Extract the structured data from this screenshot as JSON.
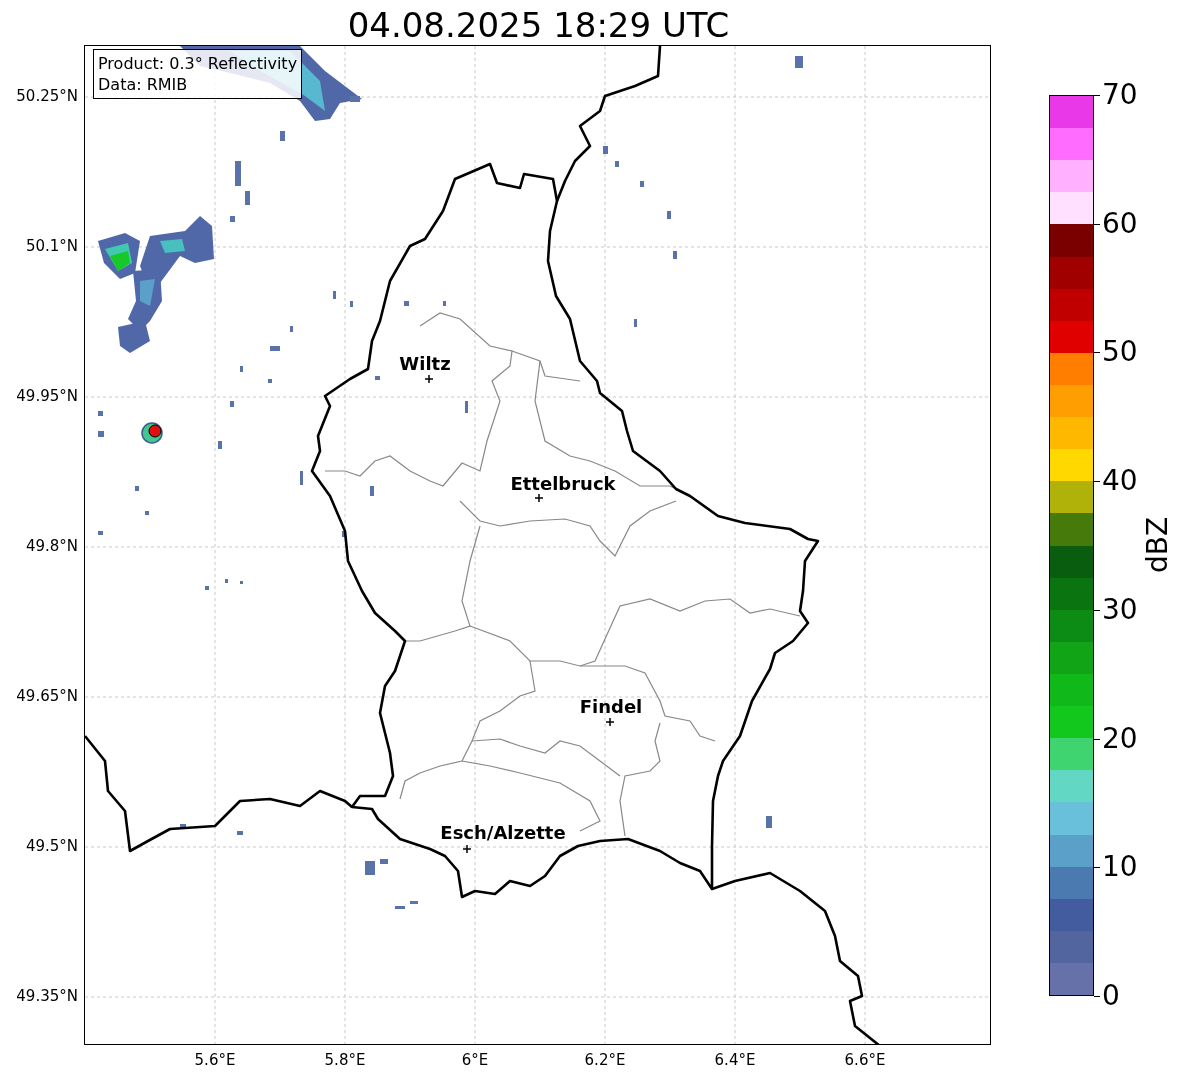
{
  "title": "04.08.2025 18:29 UTC",
  "info_box": {
    "lines": [
      "Product: 0.3° Reflectivity",
      "Data: RMIB"
    ]
  },
  "map": {
    "cities": [
      {
        "name": "Wiltz"
      },
      {
        "name": "Ettelbruck"
      },
      {
        "name": "Findel"
      },
      {
        "name": "Esch/Alzette"
      }
    ],
    "lon_labels": [
      "5.6°E",
      "5.8°E",
      "6°E",
      "6.2°E",
      "6.4°E",
      "6.6°E"
    ],
    "lat_labels": [
      "50.25°N",
      "50.1°N",
      "49.95°N",
      "49.8°N",
      "49.65°N",
      "49.5°N",
      "49.35°N"
    ]
  },
  "colorbar": {
    "label": "dBZ",
    "ticks": [
      "70",
      "60",
      "50",
      "40",
      "30",
      "20",
      "10",
      "0"
    ],
    "bins": [
      {
        "color": "#e838e8"
      },
      {
        "color": "#ff6cff"
      },
      {
        "color": "#ffb0ff"
      },
      {
        "color": "#ffe0ff"
      },
      {
        "color": "#7a0000"
      },
      {
        "color": "#a00000"
      },
      {
        "color": "#c00000"
      },
      {
        "color": "#e00000"
      },
      {
        "color": "#ff7e00"
      },
      {
        "color": "#ff9e00"
      },
      {
        "color": "#ffb800"
      },
      {
        "color": "#ffd800"
      },
      {
        "color": "#b0b20a"
      },
      {
        "color": "#467a0a"
      },
      {
        "color": "#085e0e"
      },
      {
        "color": "#0a7410"
      },
      {
        "color": "#0c8c14"
      },
      {
        "color": "#10a416"
      },
      {
        "color": "#10b81a"
      },
      {
        "color": "#12c81c"
      },
      {
        "color": "#40d470"
      },
      {
        "color": "#62d8c4"
      },
      {
        "color": "#68c0da"
      },
      {
        "color": "#5aa0c8"
      },
      {
        "color": "#4a7ab0"
      },
      {
        "color": "#435ca0"
      },
      {
        "color": "#52659e"
      },
      {
        "color": "#6571a8"
      }
    ]
  }
}
